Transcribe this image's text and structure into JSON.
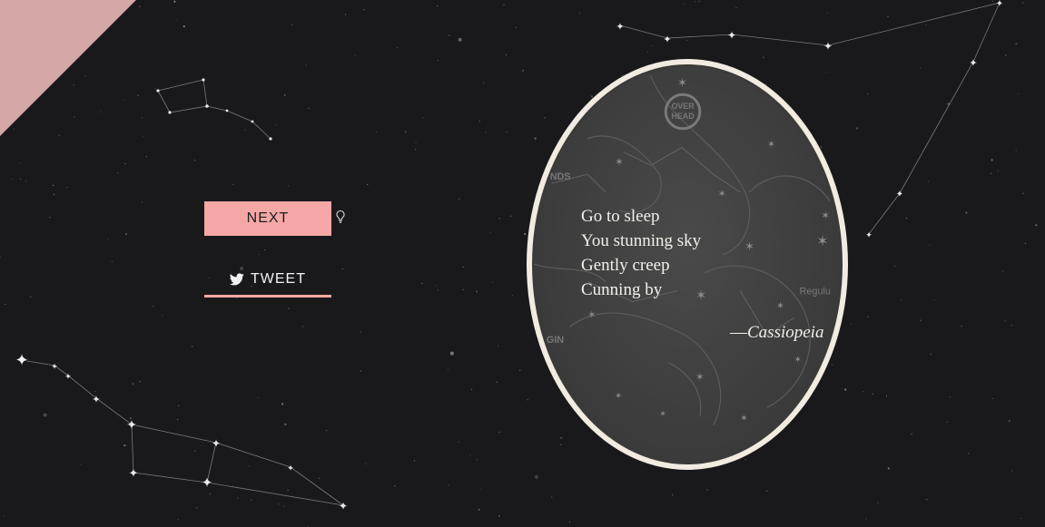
{
  "controls": {
    "next_label": "NEXT",
    "tweet_label": "TWEET"
  },
  "poem": {
    "lines": [
      "Go to sleep",
      "You stunning sky",
      "Gently creep",
      "Cunning by"
    ],
    "author_prefix": "—",
    "author": "Cassiopeia"
  },
  "map_labels": {
    "overhead_top": "OVER",
    "overhead_bottom": "HEAD",
    "hounds": "UNDS",
    "virgin": "GIN",
    "regulus": "Regulu"
  },
  "colors": {
    "background": "#19191b",
    "accent": "#f4a7a5",
    "corner": "#d5a6a6",
    "frame": "#f1ebe1"
  },
  "icons": {
    "hint": "lightbulb-icon",
    "tweet": "twitter-bird-icon"
  }
}
